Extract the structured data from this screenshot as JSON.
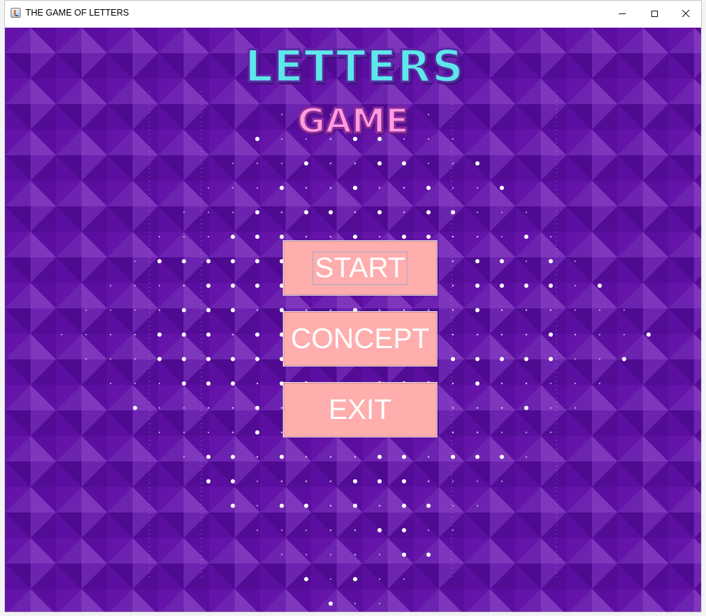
{
  "window": {
    "title": "THE GAME OF LETTERS",
    "icon": "java-cup-icon",
    "controls": [
      "minimize-icon",
      "maximize-icon",
      "close-icon"
    ]
  },
  "logo": {
    "line1": "LETTERS",
    "line2": "GAME",
    "colors": {
      "line1": "#5ee7ea",
      "line2": "#ff9ce0"
    }
  },
  "menu": {
    "start_label": "START",
    "concept_label": "CONCEPT",
    "exit_label": "EXIT",
    "button_color": "#ffadad"
  },
  "background": {
    "base_color": "#5b0fa0",
    "pattern": "purple diamond tiles with white dot grid"
  }
}
